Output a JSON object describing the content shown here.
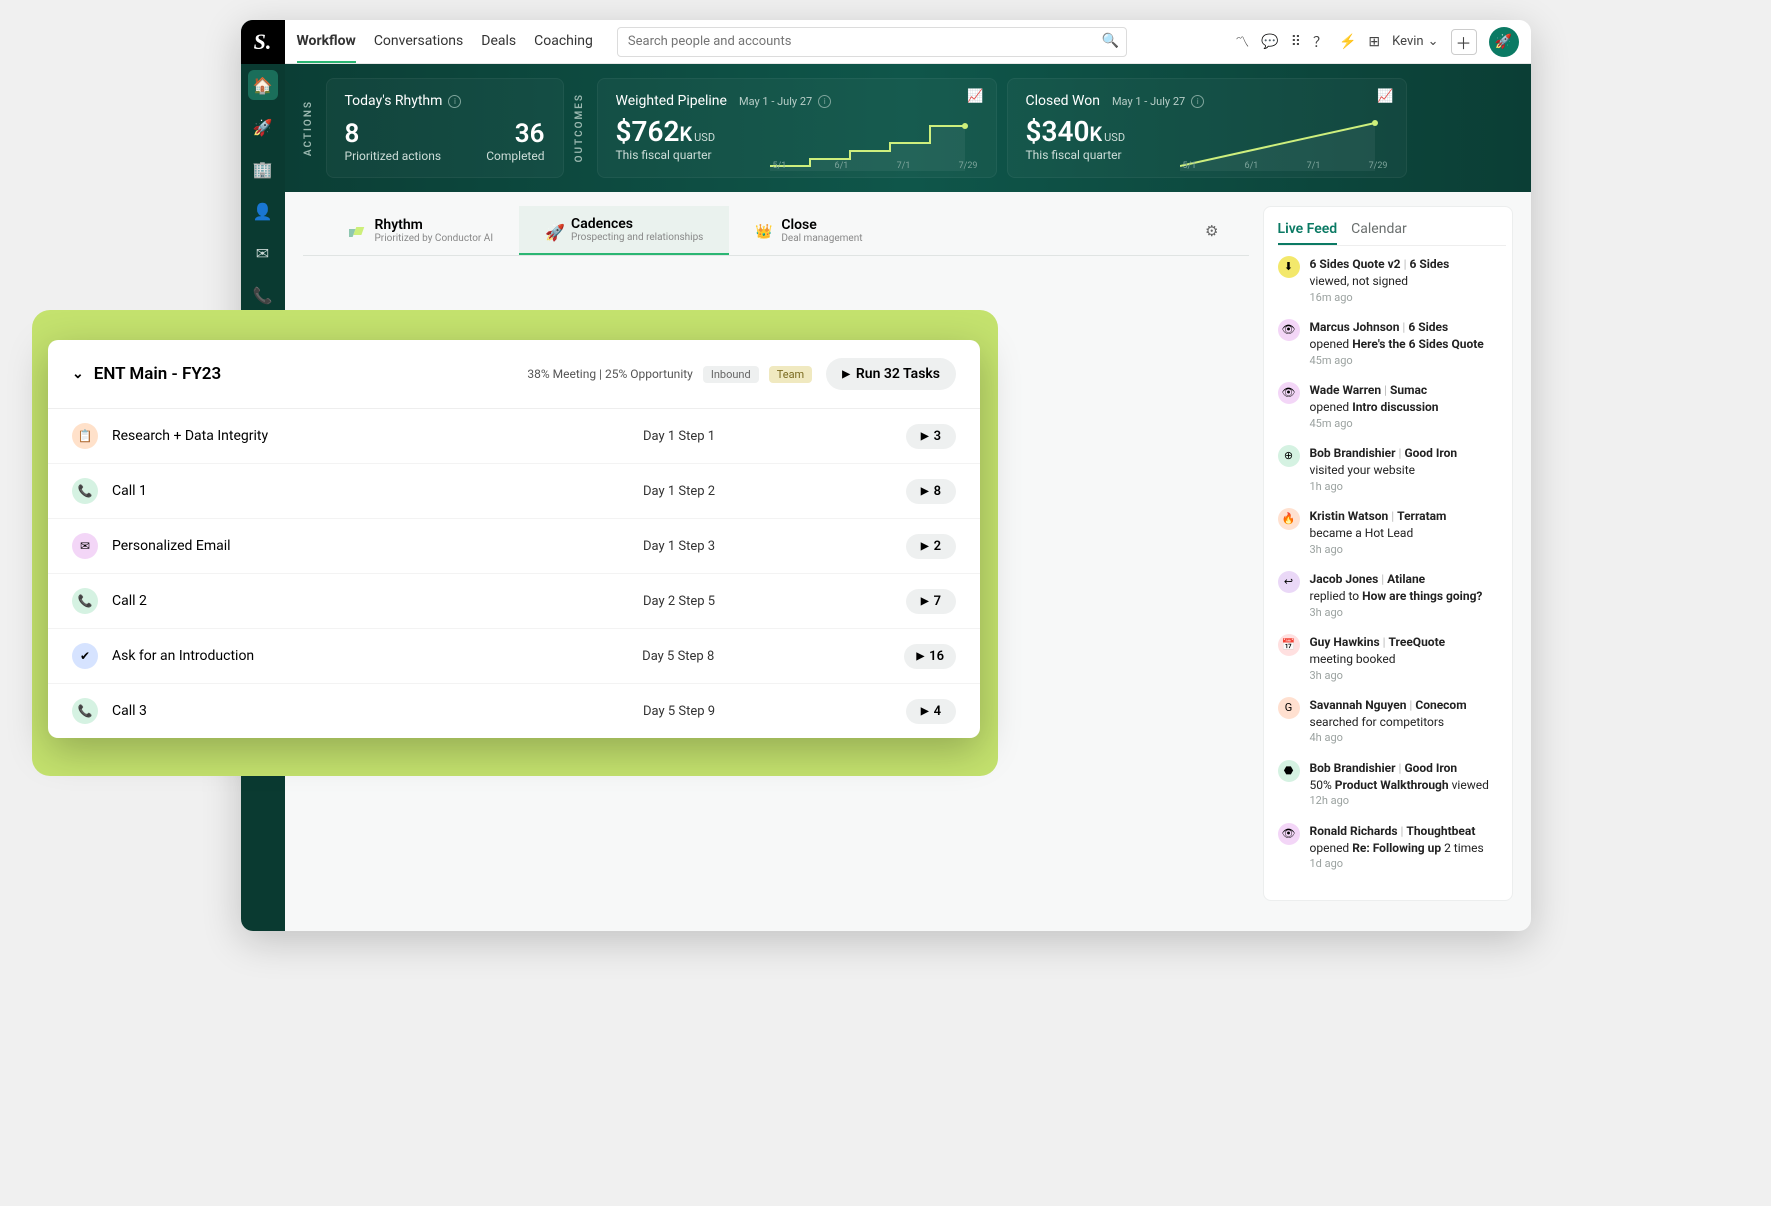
{
  "topnav": {
    "items": [
      "Workflow",
      "Conversations",
      "Deals",
      "Coaching"
    ],
    "search_placeholder": "Search people and accounts",
    "user": "Kevin"
  },
  "hero": {
    "actions_label": "ACTIONS",
    "outcomes_label": "OUTCOMES",
    "rhythm": {
      "title": "Today's Rhythm",
      "n1": "8",
      "l1": "Prioritized actions",
      "n2": "36",
      "l2": "Completed"
    },
    "pipeline": {
      "title": "Weighted Pipeline",
      "daterange": "May 1 - July 27",
      "value": "$762",
      "k": "K",
      "curr": "USD",
      "period": "This fiscal quarter",
      "ticks": [
        "5/1",
        "6/1",
        "7/1",
        "7/29"
      ]
    },
    "closed": {
      "title": "Closed Won",
      "daterange": "May 1 - July 27",
      "value": "$340",
      "k": "K",
      "curr": "USD",
      "period": "This fiscal quarter",
      "ticks": [
        "5/1",
        "6/1",
        "7/1",
        "7/29"
      ]
    }
  },
  "tabs3": [
    {
      "label": "Rhythm",
      "sub": "Prioritized by Conductor AI"
    },
    {
      "label": "Cadences",
      "sub": "Prospecting and relationships"
    },
    {
      "label": "Close",
      "sub": "Deal management"
    }
  ],
  "feedtabs": [
    "Live Feed",
    "Calendar"
  ],
  "feed": [
    {
      "icon": "⬇",
      "ic": "#f3e86b",
      "title": "6 Sides Quote v2",
      "sep": "|",
      "company": "6 Sides",
      "text": "viewed, not signed",
      "time": "16m ago"
    },
    {
      "icon": "👁",
      "ic": "#f3d6f7",
      "title": "Marcus Johnson",
      "sep": "|",
      "company": "6 Sides",
      "verb": "opened ",
      "object": "Here's the 6 Sides Quote",
      "time": "45m ago"
    },
    {
      "icon": "👁",
      "ic": "#f3d6f7",
      "title": "Wade Warren",
      "sep": "|",
      "company": "Sumac",
      "verb": "opened ",
      "object": "Intro discussion",
      "time": "45m ago"
    },
    {
      "icon": "⊕",
      "ic": "#d5f2e2",
      "title": "Bob Brandishier",
      "sep": "|",
      "company": "Good Iron",
      "text": "visited your website",
      "time": "1h ago"
    },
    {
      "icon": "🔥",
      "ic": "#ffe1d0",
      "title": "Kristin Watson",
      "sep": "|",
      "company": "Terratam",
      "text": "became a Hot Lead",
      "time": "3h ago"
    },
    {
      "icon": "↩",
      "ic": "#ead8f7",
      "title": "Jacob Jones",
      "sep": "|",
      "company": "Atilane",
      "verb": "replied to ",
      "object": "How are things going?",
      "time": "3h ago"
    },
    {
      "icon": "📅",
      "ic": "#ffe0e0",
      "title": "Guy Hawkins",
      "sep": "|",
      "company": "TreeQuote",
      "text": "meeting booked",
      "time": "3h ago"
    },
    {
      "icon": "G",
      "ic": "#ffe0d0",
      "title": "Savannah Nguyen",
      "sep": "|",
      "company": "Conecom",
      "text": "searched for competitors",
      "time": "4h ago"
    },
    {
      "icon": "⬣",
      "ic": "#d5f2e2",
      "title": "Bob Brandishier",
      "sep": "|",
      "company": "Good Iron",
      "prefix": "50% ",
      "object": "Product Walkthrough",
      "suffix": " viewed",
      "time": "12h ago"
    },
    {
      "icon": "👁",
      "ic": "#f3d6f7",
      "title": "Ronald Richards",
      "sep": "|",
      "company": "Thoughtbeat",
      "verb": "opened ",
      "object": "Re: Following up",
      "suffix": " 2 times",
      "time": "1d ago"
    }
  ],
  "modal": {
    "title": "ENT Main - FY23",
    "stats": "38% Meeting | 25% Opportunity",
    "badges": [
      "Inbound",
      "Team"
    ],
    "run": "Run 32 Tasks",
    "rows": [
      {
        "icon": "📋",
        "bg": "#ffe1ca",
        "label": "Research + Data Integrity",
        "step": "Day 1 Step 1",
        "count": "3"
      },
      {
        "icon": "📞",
        "bg": "#d5f2e2",
        "label": "Call 1",
        "step": "Day 1 Step 2",
        "count": "8"
      },
      {
        "icon": "✉",
        "bg": "#f3d6f7",
        "label": "Personalized Email",
        "step": "Day 1 Step 3",
        "count": "2"
      },
      {
        "icon": "📞",
        "bg": "#d5f2e2",
        "label": "Call 2",
        "step": "Day 2 Step 5",
        "count": "7"
      },
      {
        "icon": "✔",
        "bg": "#d6e3ff",
        "label": "Ask for an Introduction",
        "step": "Day 5 Step 8",
        "count": "16"
      },
      {
        "icon": "📞",
        "bg": "#d5f2e2",
        "label": "Call 3",
        "step": "Day 5 Step 9",
        "count": "4"
      }
    ]
  }
}
